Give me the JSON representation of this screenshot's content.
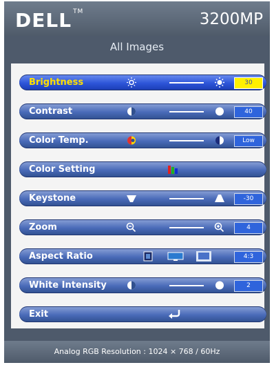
{
  "header": {
    "brand": "DELL",
    "trademark": "TM",
    "model": "3200MP"
  },
  "title": "All Images",
  "menu": [
    {
      "label": "Brightness",
      "value": "30",
      "selected": true
    },
    {
      "label": "Contrast",
      "value": "40"
    },
    {
      "label": "Color Temp.",
      "value": "Low"
    },
    {
      "label": "Color Setting"
    },
    {
      "label": "Keystone",
      "value": "-30"
    },
    {
      "label": "Zoom",
      "value": "4"
    },
    {
      "label": "Aspect Ratio",
      "value": "4:3"
    },
    {
      "label": "White Intensity",
      "value": "2"
    },
    {
      "label": "Exit"
    }
  ],
  "footer": "Analog RGB Resolution : 1024 × 768 / 60Hz",
  "colors": {
    "frame": "#4e5a6b",
    "row": "#496ab8",
    "selected_value_bg": "#fff000",
    "value_bg": "#2f64dc"
  }
}
